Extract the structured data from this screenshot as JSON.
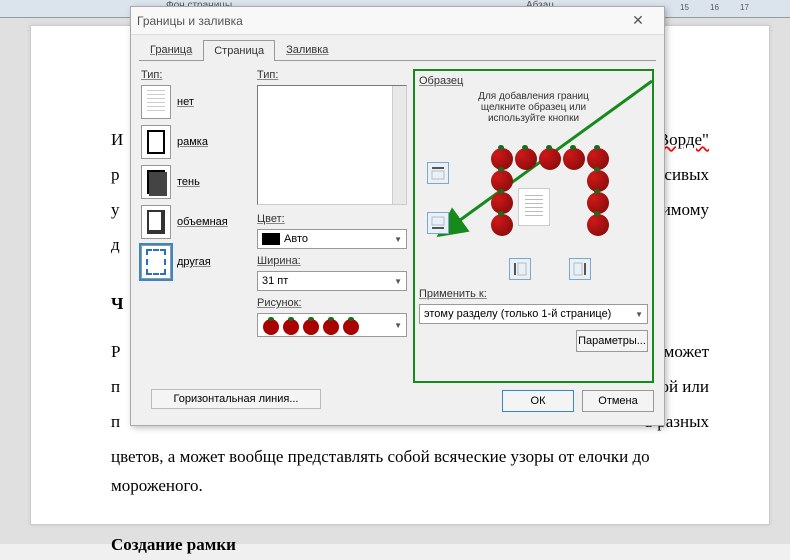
{
  "ribbon": {
    "fragment1": "Фон страницы",
    "fragment2": "Абзац"
  },
  "ruler": {
    "mark15": "15",
    "mark16": "16",
    "mark17": "17"
  },
  "dialog": {
    "title": "Границы и заливка",
    "tabs": {
      "border": "Граница",
      "page": "Страница",
      "shading": "Заливка"
    },
    "type_label": "Тип:",
    "types": {
      "none": "нет",
      "box": "рамка",
      "shadow": "тень",
      "threeD": "объемная",
      "custom": "другая"
    },
    "style_label": "Тип:",
    "color_label": "Цвет:",
    "color_value": "Авто",
    "width_label": "Ширина:",
    "width_value": "31 пт",
    "art_label": "Рисунок:",
    "preview_label": "Образец",
    "preview_hint_1": "Для добавления границ",
    "preview_hint_2": "щелкните образец или",
    "preview_hint_3": "используйте кнопки",
    "apply_label": "Применить к:",
    "apply_value": "этому разделу (только 1-й странице)",
    "options_btn": "Параметры...",
    "hline_btn": "Горизонтальная линия...",
    "ok": "ОК",
    "cancel": "Отмена"
  },
  "doc": {
    "p1a": "И",
    "p1b": "\"Ворде\"",
    "p2a": "р",
    "p2b": "красивых",
    "p3a": "у",
    "p3b": "ржимому",
    "p4": "д",
    "h1": "Ч",
    "p5a": "Р",
    "p5b": "ая может",
    "p6a": "п",
    "p6b": "иной или",
    "p7a": "п",
    "p7b": "ь разных",
    "p8": "цветов, а может вообще представлять собой всяческие узоры от елочки до мороженого.",
    "h2": "Создание рамки"
  }
}
